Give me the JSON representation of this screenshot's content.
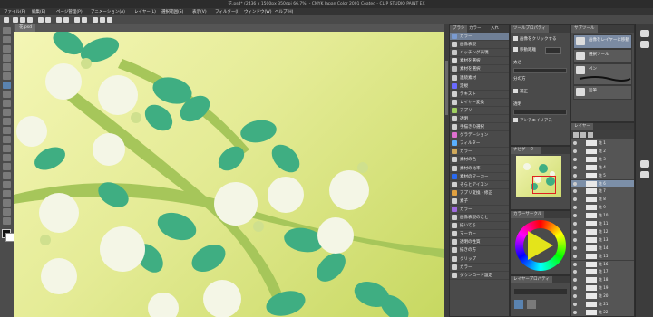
{
  "window": {
    "title": "花.psd* (2436 x 1500px 350dpi 66.7%) - CMYK Japan Color 2001 Coated - CLIP STUDIO PAINT EX"
  },
  "menu": [
    "ファイル(F)",
    "編集(E)",
    "ページ管理(P)",
    "アニメーション(A)",
    "レイヤー(L)",
    "選択範囲(S)",
    "表示(V)",
    "フィルター(I)",
    "ウィンドウ(W)",
    "ヘルプ(H)"
  ],
  "document": {
    "tab": "花.psd"
  },
  "brush_panel": {
    "tabs": [
      "ブラシ",
      "カラー",
      "入れ"
    ],
    "items": [
      {
        "label": "カラー",
        "color": "#7a9bd1"
      },
      {
        "label": "画像表現",
        "color": "#d0d0d0"
      },
      {
        "label": "ハッチング表現",
        "color": "#c8c8c8"
      },
      {
        "label": "素材を選択",
        "color": "#d9d9d9"
      },
      {
        "label": "素材を選択",
        "color": "#bfbfbf"
      },
      {
        "label": "連続素材",
        "color": "#d0d0d0"
      },
      {
        "label": "定規",
        "color": "#6a6aff"
      },
      {
        "label": "テキスト",
        "color": "#d0d0d0"
      },
      {
        "label": "レイヤー変換",
        "color": "#d0d0d0"
      },
      {
        "label": "アプリ",
        "color": "#9fcf5f"
      },
      {
        "label": "透明",
        "color": "#d0d0d0"
      },
      {
        "label": "手描きの選択",
        "color": "#d0d0d0"
      },
      {
        "label": "グラデーション",
        "color": "#e070d0"
      },
      {
        "label": "フィルター",
        "color": "#5ab0ff"
      },
      {
        "label": "カラー",
        "color": "#cfa85a"
      },
      {
        "label": "素材の色",
        "color": "#d0d0d0"
      },
      {
        "label": "素材の比率",
        "color": "#d0d0d0"
      },
      {
        "label": "素材のマーカー",
        "color": "#2a6af0"
      },
      {
        "label": "そらとアイコン",
        "color": "#d0d0d0"
      },
      {
        "label": "アプリ変換・修正",
        "color": "#e0a040"
      },
      {
        "label": "素子",
        "color": "#d0d0d0"
      },
      {
        "label": "カラー",
        "color": "#9f6ae0"
      },
      {
        "label": "画像表現のこと",
        "color": "#d0d0d0"
      },
      {
        "label": "描いてる",
        "color": "#d0d0d0"
      },
      {
        "label": "マーカー",
        "color": "#d0d0d0"
      },
      {
        "label": "透明の性質",
        "color": "#d0d0d0"
      },
      {
        "label": "描きの方",
        "color": "#d0d0d0"
      },
      {
        "label": "クリップ",
        "color": "#d0d0d0"
      },
      {
        "label": "カラー",
        "color": "#d0d0d0"
      },
      {
        "label": "ダウンロード設定",
        "color": "#d0d0d0"
      }
    ]
  },
  "tool_property": {
    "tab": "ツールプロパティ",
    "rows": [
      "画像をクリックする",
      "移動距離",
      "太さ",
      "分の方",
      "補正",
      "透明",
      "アンチエイリアス"
    ]
  },
  "subtool": {
    "tab": "サブツール",
    "items": [
      "画像をレイヤーに移動",
      "選択ツール",
      "ペン",
      "鉛筆"
    ],
    "selected_index": 0
  },
  "layer_panel": {
    "tab": "レイヤー",
    "layers": [
      "花 1",
      "花 2",
      "花 3",
      "花 4",
      "花 5",
      "花 6",
      "花 7",
      "花 8",
      "花 9",
      "花 10",
      "花 11",
      "花 12",
      "花 13",
      "花 14",
      "花 15",
      "花 16",
      "花 17",
      "花 18",
      "花 19",
      "花 20",
      "花 21",
      "花 22"
    ],
    "selected_index": 5
  },
  "navigator": {
    "tab": "ナビゲーター"
  },
  "color_wheel": {
    "tab": "カラーサークル"
  },
  "layer_property": {
    "tab": "レイヤープロパティ"
  }
}
